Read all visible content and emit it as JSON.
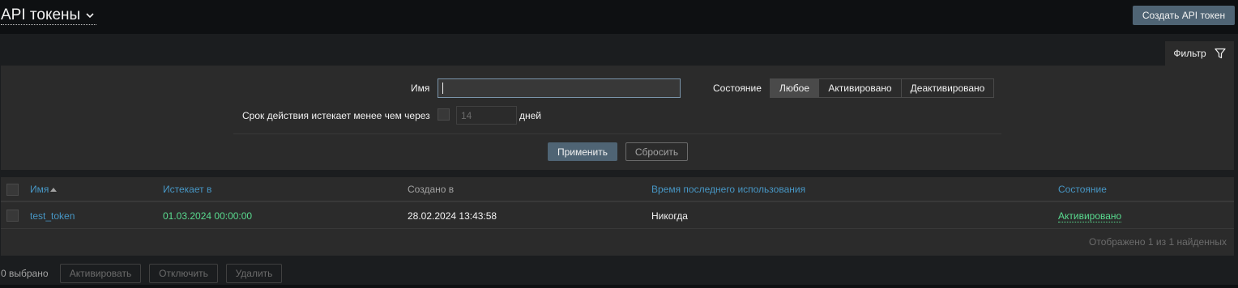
{
  "header": {
    "title": "API токены",
    "create_button": "Создать API токен"
  },
  "filter": {
    "tab_label": "Фильтр",
    "name_label": "Имя",
    "name_value": "",
    "status_label": "Состояние",
    "status_options": [
      "Любое",
      "Активировано",
      "Деактивировано"
    ],
    "status_selected": "Любое",
    "expires_label": "Срок действия истекает менее чем через",
    "expires_days_value": "14",
    "expires_days_unit": "дней",
    "apply_button": "Применить",
    "reset_button": "Сбросить"
  },
  "table": {
    "columns": [
      "Имя",
      "Истекает в",
      "Создано в",
      "Время последнего использования",
      "Состояние"
    ],
    "rows": [
      {
        "name": "test_token",
        "expires_at": "01.03.2024 00:00:00",
        "created_at": "28.02.2024 13:43:58",
        "last_used": "Никогда",
        "status": "Активировано"
      }
    ],
    "footer": "Отображено 1 из 1 найденных"
  },
  "mass_actions": {
    "selected_count": "0 выбрано",
    "enable_button": "Активировать",
    "disable_button": "Отключить",
    "delete_button": "Удалить"
  },
  "colors": {
    "background": "#0e1012",
    "panel": "#2b2b2b",
    "link": "#4796c4",
    "success": "#59db8f",
    "primary_button": "#4f6474"
  }
}
